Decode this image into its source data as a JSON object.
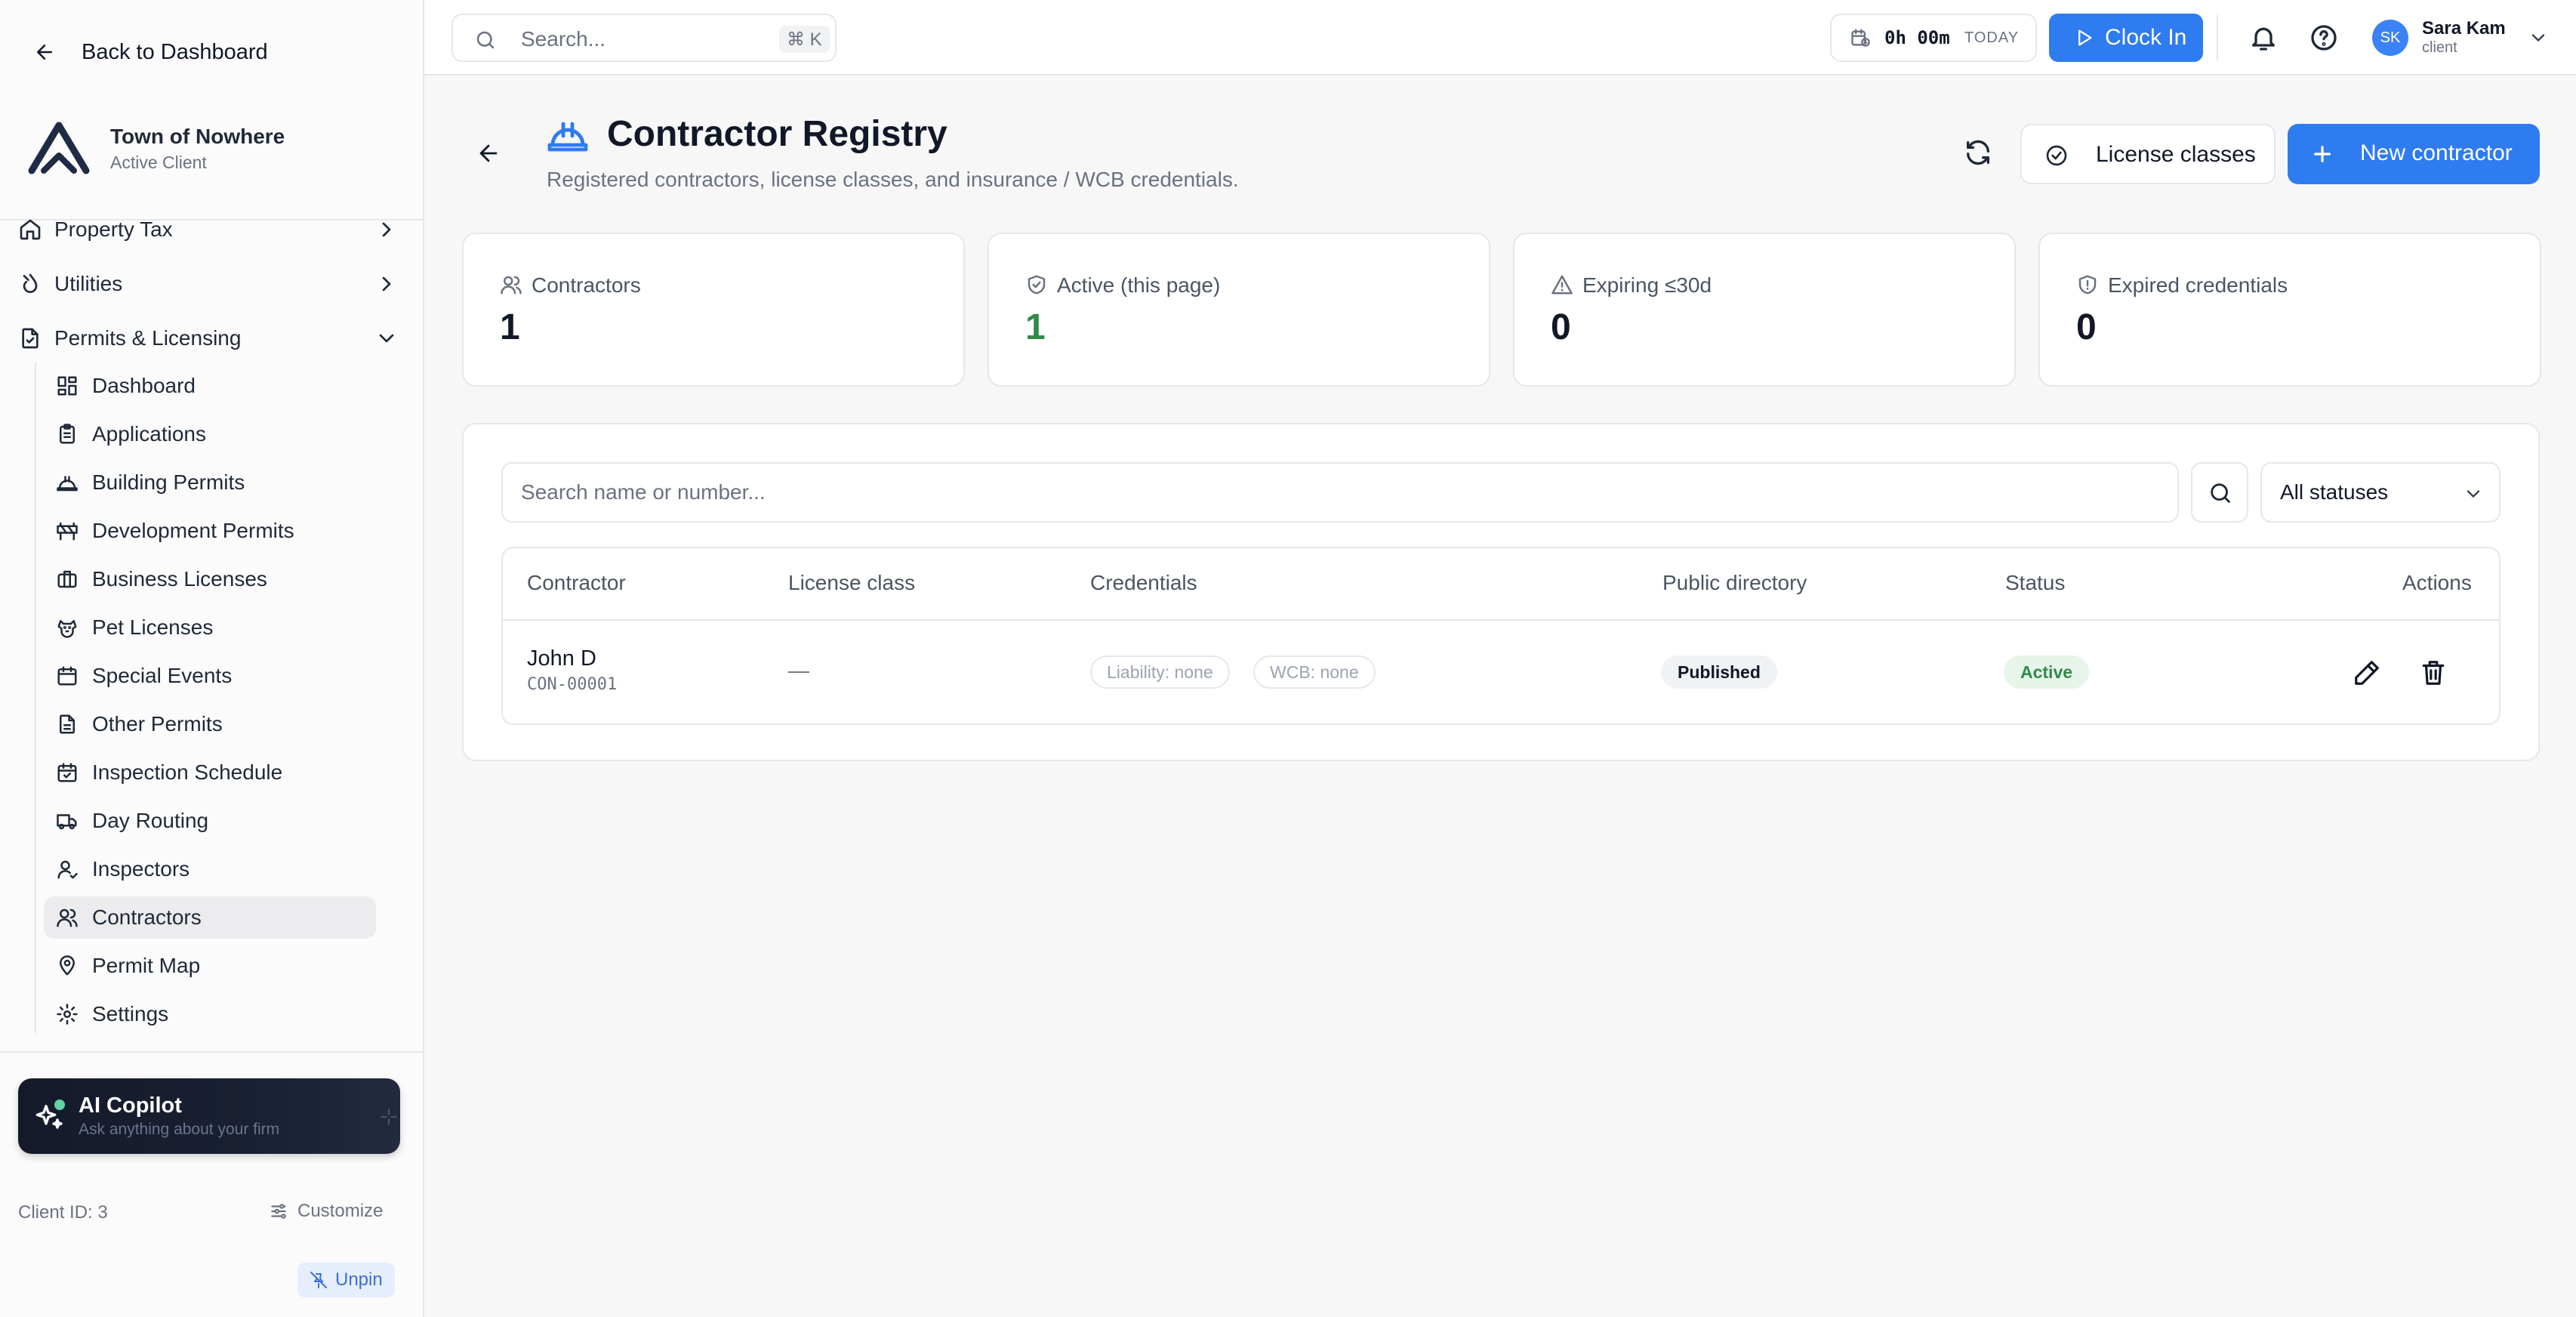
{
  "sidebar": {
    "back_label": "Back to Dashboard",
    "org_name": "Town of Nowhere",
    "org_status": "Active Client",
    "groups": [
      {
        "label": "Property Tax"
      },
      {
        "label": "Utilities"
      },
      {
        "label": "Permits & Licensing"
      }
    ],
    "items": [
      {
        "label": "Dashboard",
        "icon": "dashboard-icon"
      },
      {
        "label": "Applications",
        "icon": "clipboard-icon"
      },
      {
        "label": "Building Permits",
        "icon": "hard-hat-icon"
      },
      {
        "label": "Development Permits",
        "icon": "barrier-icon"
      },
      {
        "label": "Business Licenses",
        "icon": "briefcase-icon"
      },
      {
        "label": "Pet Licenses",
        "icon": "dog-icon"
      },
      {
        "label": "Special Events",
        "icon": "calendar-icon"
      },
      {
        "label": "Other Permits",
        "icon": "file-icon"
      },
      {
        "label": "Inspection Schedule",
        "icon": "calendar-check-icon"
      },
      {
        "label": "Day Routing",
        "icon": "truck-icon"
      },
      {
        "label": "Inspectors",
        "icon": "user-icon"
      },
      {
        "label": "Contractors",
        "icon": "users-icon"
      },
      {
        "label": "Permit Map",
        "icon": "map-pin-icon"
      },
      {
        "label": "Settings",
        "icon": "gear-icon"
      }
    ],
    "copilot_title": "AI Copilot",
    "copilot_sub": "Ask anything about your firm",
    "client_id": "Client ID: 3",
    "customize_label": "Customize",
    "unpin_label": "Unpin"
  },
  "topbar": {
    "search_placeholder": "Search...",
    "search_shortcut": "⌘ K",
    "timer_value": "0h 00m",
    "timer_label": "TODAY",
    "clockin_label": "Clock In",
    "user_initials": "SK",
    "user_name": "Sara Kam",
    "user_role": "client"
  },
  "page": {
    "title": "Contractor Registry",
    "subtitle": "Registered contractors, license classes, and insurance / WCB credentials.",
    "license_classes_label": "License classes",
    "new_contractor_label": "New contractor"
  },
  "stats": [
    {
      "label": "Contractors",
      "value": "1",
      "color": "#111827"
    },
    {
      "label": "Active (this page)",
      "value": "1",
      "color": "#2f8a4a"
    },
    {
      "label": "Expiring ≤30d",
      "value": "0",
      "color": "#111827"
    },
    {
      "label": "Expired credentials",
      "value": "0",
      "color": "#111827"
    }
  ],
  "table": {
    "search_placeholder": "Search name or number...",
    "status_filter": "All statuses",
    "columns": [
      "Contractor",
      "License class",
      "Credentials",
      "Public directory",
      "Status",
      "Actions"
    ],
    "rows": [
      {
        "name": "John D",
        "number": "CON-00001",
        "license_class": "—",
        "liability": "Liability: none",
        "wcb": "WCB: none",
        "directory": "Published",
        "status": "Active"
      }
    ]
  },
  "colors": {
    "accent": "#2f7bf0",
    "success": "#2f8a4a"
  }
}
